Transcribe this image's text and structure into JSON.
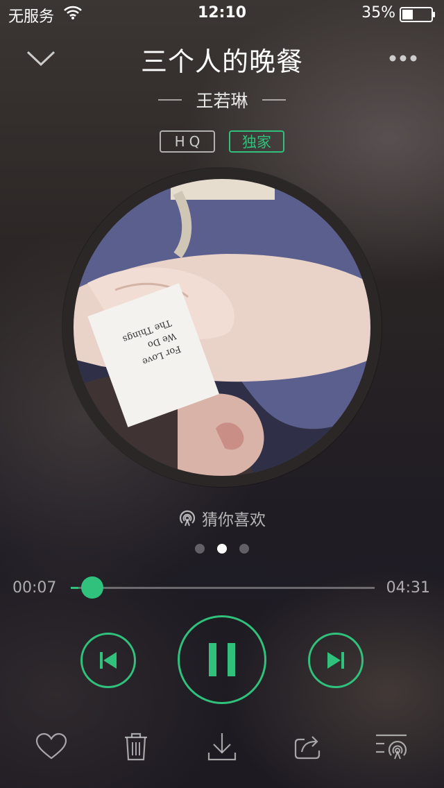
{
  "status_bar": {
    "carrier": "无服务",
    "time": "12:10",
    "battery": "35%"
  },
  "song": {
    "title": "三个人的晚餐",
    "artist": "王若琳"
  },
  "badges": {
    "hq": "HQ",
    "exclusive": "独家"
  },
  "album_art": {
    "card_lines": [
      "The Things",
      "We Do",
      "For Love"
    ]
  },
  "recommendation": {
    "label": "猜你喜欢"
  },
  "pager": {
    "pages": 3,
    "active_index": 1
  },
  "progress": {
    "elapsed": "00:07",
    "total": "04:31",
    "fraction": 0.026
  },
  "colors": {
    "accent": "#30c27c"
  },
  "icons": {
    "collapse": "chevron-down-icon",
    "more": "more-dots-icon",
    "prev": "skip-previous-icon",
    "pause": "pause-icon",
    "next": "skip-next-icon",
    "like": "heart-icon",
    "delete": "trash-icon",
    "download": "download-icon",
    "share": "share-icon",
    "playlist": "playlist-icon"
  }
}
